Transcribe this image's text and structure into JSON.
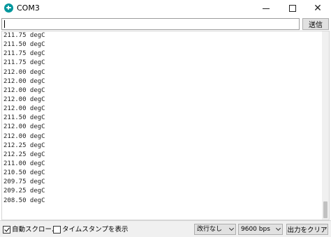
{
  "window": {
    "title": "COM3",
    "icon": "arduino-icon",
    "controls": {
      "minimize": "—",
      "maximize": "☐",
      "close": "✕"
    }
  },
  "send": {
    "value": "",
    "button_label": "送信"
  },
  "output": {
    "lines": [
      "211.75 degC",
      "211.50 degC",
      "211.75 degC",
      "211.75 degC",
      "212.00 degC",
      "212.00 degC",
      "212.00 degC",
      "212.00 degC",
      "212.00 degC",
      "211.50 degC",
      "212.00 degC",
      "212.00 degC",
      "212.25 degC",
      "212.25 degC",
      "211.00 degC",
      "210.50 degC",
      "209.75 degC",
      "209.25 degC",
      "208.50 degC"
    ]
  },
  "footer": {
    "autoscroll": {
      "label": "自動スクロール",
      "checked": true
    },
    "timestamp": {
      "label": "タイムスタンプを表示",
      "checked": false
    },
    "line_ending": "改行なし",
    "baud_rate": "9600 bps",
    "clear_label": "出力をクリア"
  },
  "colors": {
    "accent": "#00979d"
  }
}
